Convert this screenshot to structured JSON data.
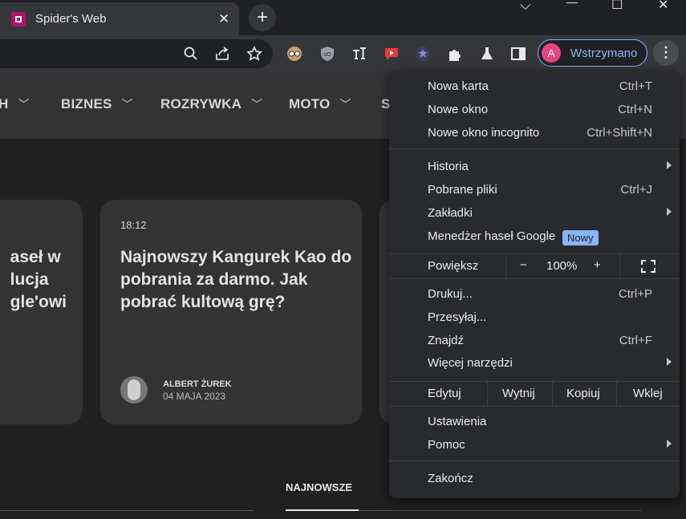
{
  "tab": {
    "title": "Spider's Web",
    "close": "✕"
  },
  "newtab": "+",
  "window": {
    "dropdown": "⌵",
    "minimize": "—",
    "maximize": "☐",
    "close": "✕"
  },
  "toolbar": {
    "profile_initial": "A",
    "profile_name": "Wstrzymano",
    "menu_glyph": "⋮"
  },
  "site_nav": {
    "items": [
      {
        "label": "H"
      },
      {
        "label": "BIZNES"
      },
      {
        "label": "ROZRYWKA"
      },
      {
        "label": "MOTO"
      },
      {
        "label": "S"
      }
    ]
  },
  "cards": {
    "left_lines": [
      "aseł w",
      "lucja",
      "gle'owi"
    ],
    "main": {
      "time": "18:12",
      "title": "Najnowszy Kangurek Kao do pobrania za darmo. Jak pobrać kultową grę?",
      "author": "ALBERT ŻUREK",
      "date": "04 MAJA 2023"
    }
  },
  "section": {
    "tab": "NAJNOWSZE"
  },
  "menu": {
    "new_tab": {
      "label": "Nowa karta",
      "shortcut": "Ctrl+T"
    },
    "new_window": {
      "label": "Nowe okno",
      "shortcut": "Ctrl+N"
    },
    "incognito": {
      "label": "Nowe okno incognito",
      "shortcut": "Ctrl+Shift+N"
    },
    "history": {
      "label": "Historia"
    },
    "downloads": {
      "label": "Pobrane pliki",
      "shortcut": "Ctrl+J"
    },
    "bookmarks": {
      "label": "Zakładki"
    },
    "passwords": {
      "label": "Menedżer haseł Google",
      "badge": "Nowy"
    },
    "zoom": {
      "label": "Powiększ",
      "minus": "−",
      "value": "100%",
      "plus": "+"
    },
    "print": {
      "label": "Drukuj...",
      "shortcut": "Ctrl+P"
    },
    "cast": {
      "label": "Przesyłaj..."
    },
    "find": {
      "label": "Znajdź",
      "shortcut": "Ctrl+F"
    },
    "more_tools": {
      "label": "Więcej narzędzi"
    },
    "edit": {
      "label": "Edytuj",
      "cut": "Wytnij",
      "copy": "Kopiuj",
      "paste": "Wklej"
    },
    "settings": {
      "label": "Ustawienia"
    },
    "help": {
      "label": "Pomoc"
    },
    "exit": {
      "label": "Zakończ"
    }
  },
  "colors": {
    "accent": "#8ab4f8",
    "favicon": "#b0126a",
    "avatar": "#e8457e"
  }
}
